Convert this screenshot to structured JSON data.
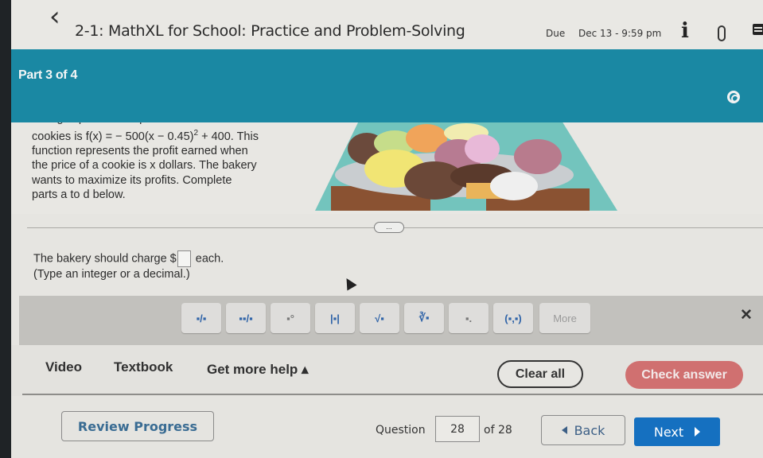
{
  "header": {
    "back_icon": "chevron-left-icon",
    "title": "2-1: MathXL for School: Practice and Problem-Solving",
    "due_label": "Due",
    "due_date": "Dec 13 - 9:59 pm",
    "icons": [
      "info-icon",
      "paperclip-icon",
      "comment-icon"
    ]
  },
  "part": {
    "label": "Part 3 of 4",
    "settings_icon": "gear-icon"
  },
  "problem": {
    "line1": "changes profits. The profit function for the",
    "line2_prefix": "cookies is f(x) = − 500(x − 0.45)",
    "line2_exp": "2",
    "line2_suffix": " + 400. This",
    "line3": "function represents the profit earned when",
    "line4": "the price of a cookie is x dollars. The bakery",
    "line5": "wants to maximize its profits. Complete",
    "line6": "parts a to d below.",
    "image_desc": "plate of cookies",
    "expand_label": "..."
  },
  "answer": {
    "prefix": "The bakery should charge $",
    "value": "",
    "suffix": "each.",
    "hint": "(Type an integer or a decimal.)"
  },
  "math_toolbar": {
    "tools": [
      {
        "name": "fraction",
        "glyph": "▪/▪"
      },
      {
        "name": "mixed-number",
        "glyph": "▪▪/▪"
      },
      {
        "name": "exponent",
        "glyph": "▪°"
      },
      {
        "name": "absolute-value",
        "glyph": "|▪|"
      },
      {
        "name": "square-root",
        "glyph": "√▪"
      },
      {
        "name": "nth-root",
        "glyph": "∛▪"
      },
      {
        "name": "decimal",
        "glyph": "▪."
      },
      {
        "name": "ordered-pair",
        "glyph": "(▪,▪)"
      }
    ],
    "more_label": "More",
    "close_glyph": "✕"
  },
  "help": {
    "video": "Video",
    "textbook": "Textbook",
    "get_more_help": "Get more help ▴",
    "clear_all": "Clear all",
    "check_answer": "Check answer"
  },
  "nav": {
    "review_progress": "Review Progress",
    "question_label": "Question",
    "question_value": "28",
    "of_total": "of 28",
    "back": "Back",
    "next": "Next"
  }
}
